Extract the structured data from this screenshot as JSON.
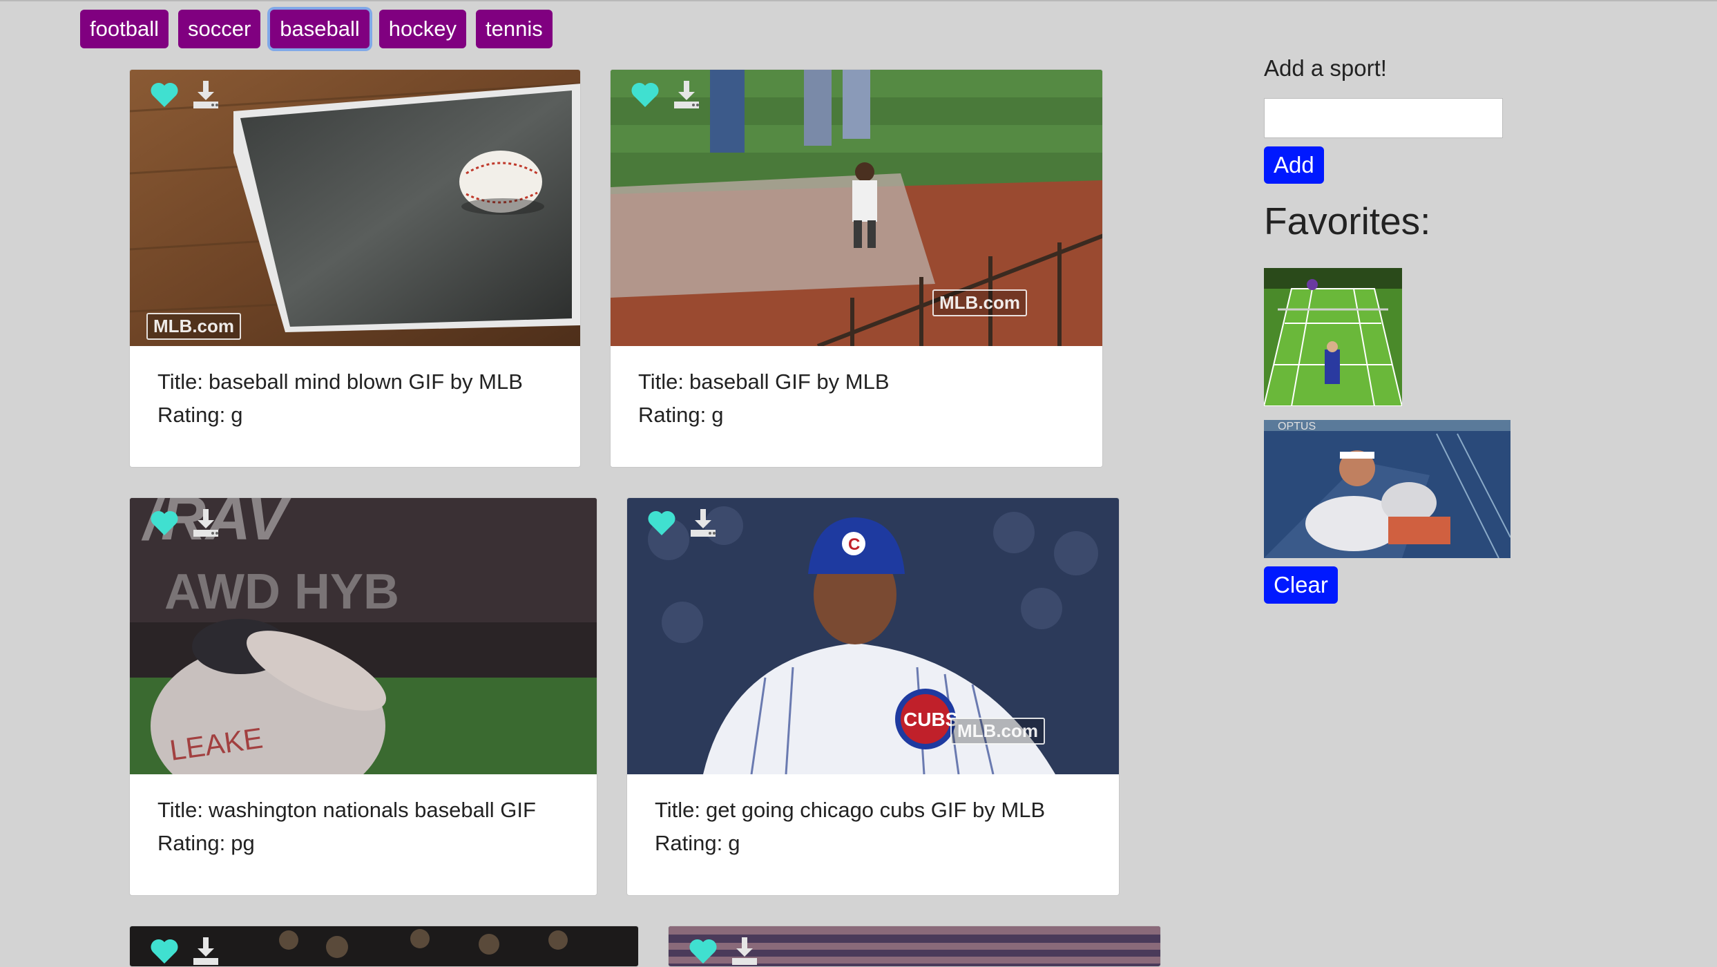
{
  "sports": [
    {
      "label": "football",
      "active": false
    },
    {
      "label": "soccer",
      "active": false
    },
    {
      "label": "baseball",
      "active": true
    },
    {
      "label": "hockey",
      "active": false
    },
    {
      "label": "tennis",
      "active": false
    }
  ],
  "gifs": [
    {
      "title_label": "Title:",
      "title": "baseball mind blown GIF by MLB",
      "rating_label": "Rating:",
      "rating": "g",
      "watermark": "MLB.com"
    },
    {
      "title_label": "Title:",
      "title": "baseball GIF by MLB",
      "rating_label": "Rating:",
      "rating": "g",
      "watermark": "MLB.com"
    },
    {
      "title_label": "Title:",
      "title": "washington nationals baseball GIF",
      "rating_label": "Rating:",
      "rating": "pg",
      "bg_text": "AWD HYB",
      "jersey_text": "LEAKE"
    },
    {
      "title_label": "Title:",
      "title": "get going chicago cubs GIF by MLB",
      "rating_label": "Rating:",
      "rating": "g",
      "watermark": "MLB.com",
      "logo_text": "CUBS"
    },
    {
      "title_label": "",
      "title": "",
      "rating_label": "",
      "rating": ""
    },
    {
      "title_label": "",
      "title": "",
      "rating_label": "",
      "rating": ""
    }
  ],
  "icons": {
    "favorite": "heart-icon",
    "download": "download-icon"
  },
  "colors": {
    "page_bg": "#d3d3d3",
    "sport_button": "#800080",
    "primary_button": "#0019ff",
    "heart": "#40e0d0",
    "download": "#e6e6e6"
  },
  "sidebar": {
    "add_label": "Add a sport!",
    "input_value": "",
    "add_button": "Add",
    "favorites_heading": "Favorites:",
    "favorites": [
      {
        "kind": "tennis-court"
      },
      {
        "kind": "tennis-player",
        "banner_text": "OPTUS"
      }
    ],
    "clear_button": "Clear"
  }
}
